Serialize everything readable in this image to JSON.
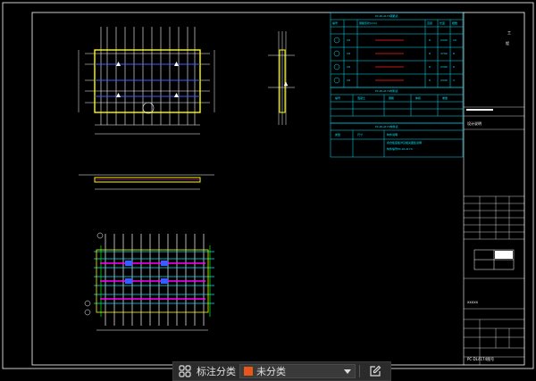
{
  "toolbar": {
    "label": "标注分类",
    "selected_value": "未分类",
    "swatch_color": "#e8561b",
    "icons": [
      "layout-grid-icon",
      "chevron-down-icon",
      "edit-icon"
    ]
  },
  "titleblock": {
    "drawing_no": "PC-DL4174图号",
    "project": "工程"
  },
  "colors": {
    "background": "#000000",
    "cyan": "#00e5ff",
    "white": "#ffffff",
    "yellow": "#ffff00",
    "magenta": "#ff00ff",
    "red": "#ff2020",
    "blue": "#3b5bff",
    "green": "#00ff00"
  }
}
